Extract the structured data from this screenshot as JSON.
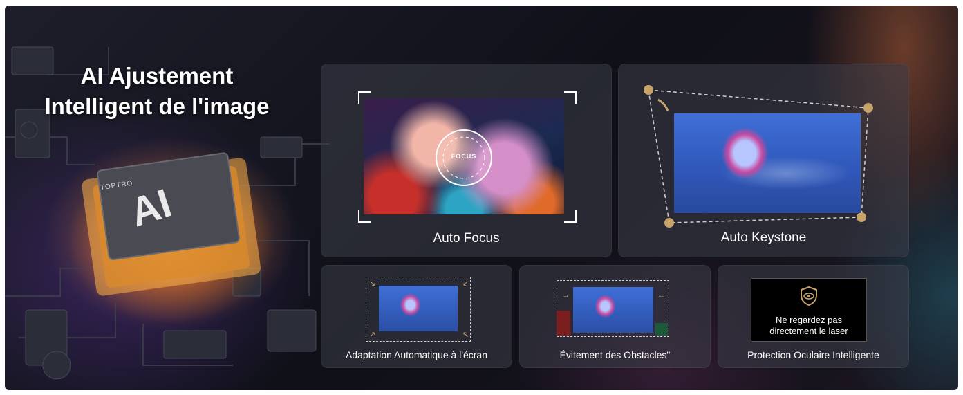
{
  "headline": {
    "line1": "AI Ajustement",
    "line2": "Intelligent de l'image"
  },
  "chip": {
    "brand": "TOPTRO",
    "label": "AI"
  },
  "features": {
    "auto_focus": {
      "label": "Auto Focus",
      "badge": "FOCUS"
    },
    "auto_keystone": {
      "label": "Auto Keystone"
    },
    "screen_fit": {
      "label": "Adaptation Automatique à l'écran"
    },
    "obstacle": {
      "label": "Évitement des Obstacles\""
    },
    "eye_protection": {
      "label": "Protection Oculaire Intelligente",
      "warning_line1": "Ne regardez pas",
      "warning_line2": "directement le laser"
    }
  },
  "colors": {
    "accent_gold": "#c9a46a",
    "chip_glow": "#ff9a2e",
    "card_bg": "#3c3e48"
  },
  "icons": [
    "shield-eye-icon",
    "arrow-icon",
    "corner-bracket-icon"
  ]
}
